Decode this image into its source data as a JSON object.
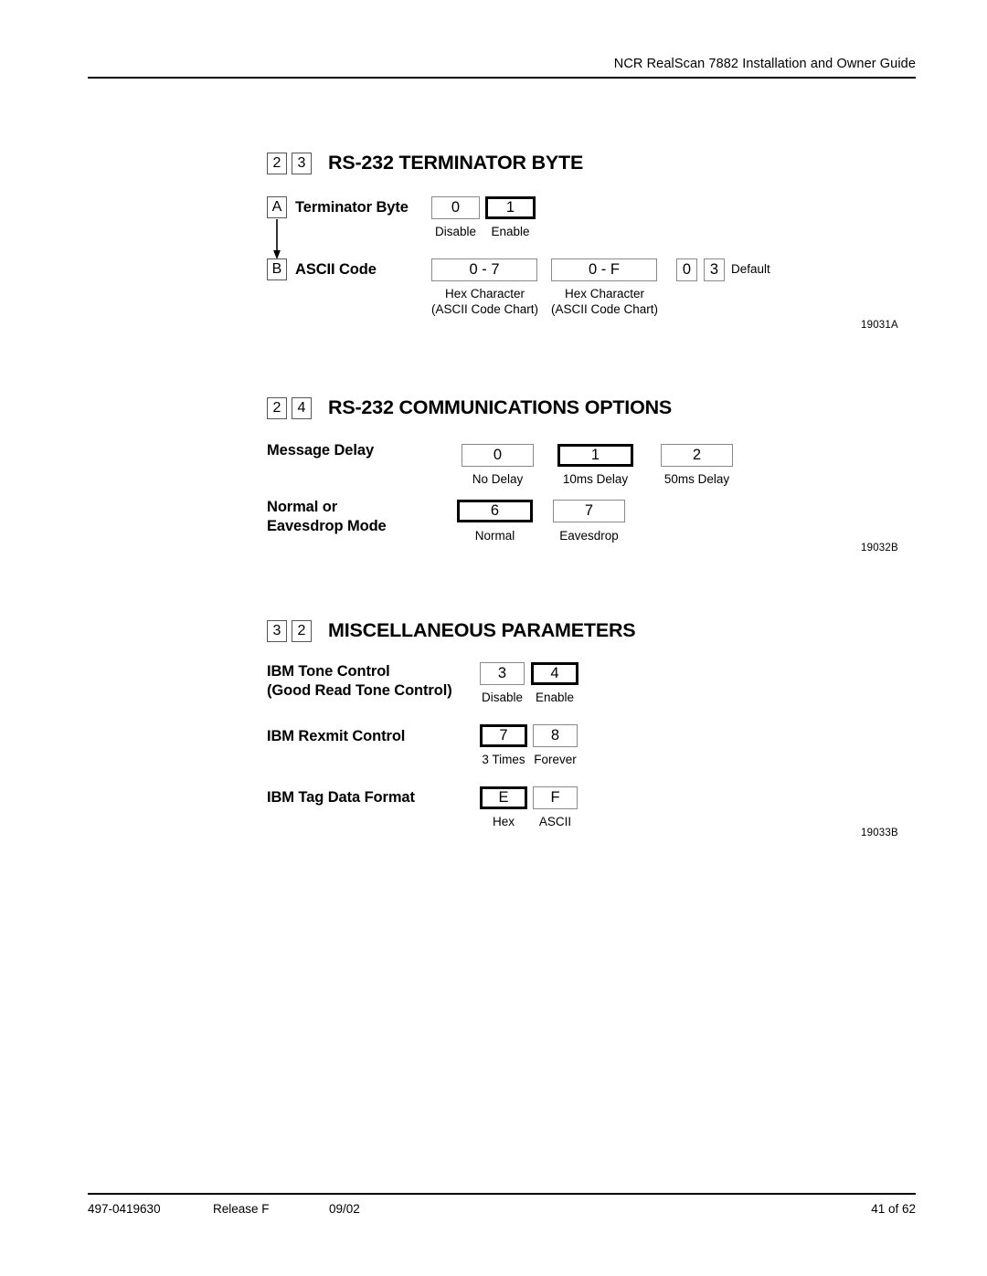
{
  "header": {
    "title": "NCR RealScan 7882 Installation and Owner Guide"
  },
  "footer": {
    "doc_number": "497-0419630",
    "release": "Release F",
    "date": "09/02",
    "page": "41 of 62"
  },
  "sections": [
    {
      "id": "rs232-terminator-byte",
      "num1": "2",
      "num2": "3",
      "title": "RS-232 TERMINATOR BYTE",
      "figure_id": "19031A",
      "rows": [
        {
          "tag": "A",
          "label": "Terminator Byte",
          "options": [
            {
              "value": "0",
              "caption": "Disable",
              "default": false
            },
            {
              "value": "1",
              "caption": "Enable",
              "default": true
            }
          ]
        },
        {
          "tag": "B",
          "label": "ASCII Code",
          "options": [
            {
              "value": "0 - 7",
              "caption": "Hex Character\n(ASCII Code Chart)",
              "default": false
            },
            {
              "value": "0 - F",
              "caption": "Hex Character\n(ASCII Code Chart)",
              "default": false
            }
          ],
          "default_tiles": [
            "0",
            "3"
          ],
          "default_label": "Default"
        }
      ]
    },
    {
      "id": "rs232-communications-options",
      "num1": "2",
      "num2": "4",
      "title": "RS-232 COMMUNICATIONS OPTIONS",
      "figure_id": "19032B",
      "rows": [
        {
          "label": "Message Delay",
          "options": [
            {
              "value": "0",
              "caption": "No Delay",
              "default": false
            },
            {
              "value": "1",
              "caption": "10ms Delay",
              "default": true
            },
            {
              "value": "2",
              "caption": "50ms Delay",
              "default": false
            }
          ]
        },
        {
          "label": "Normal or\nEavesdrop Mode",
          "label_line1": "Normal or",
          "label_line2": "Eavesdrop Mode",
          "options": [
            {
              "value": "6",
              "caption": "Normal",
              "default": true
            },
            {
              "value": "7",
              "caption": "Eavesdrop",
              "default": false
            }
          ]
        }
      ]
    },
    {
      "id": "miscellaneous-parameters",
      "num1": "3",
      "num2": "2",
      "title": "MISCELLANEOUS PARAMETERS",
      "figure_id": "19033B",
      "rows": [
        {
          "label": "IBM Tone Control\n(Good Read Tone Control)",
          "label_line1": "IBM Tone Control",
          "label_line2": "(Good Read Tone Control)",
          "options": [
            {
              "value": "3",
              "caption": "Disable",
              "default": false
            },
            {
              "value": "4",
              "caption": "Enable",
              "default": true
            }
          ]
        },
        {
          "label": "IBM Rexmit Control",
          "options": [
            {
              "value": "7",
              "caption": "3 Times",
              "default": true
            },
            {
              "value": "8",
              "caption": "Forever",
              "default": false
            }
          ]
        },
        {
          "label": "IBM Tag Data Format",
          "options": [
            {
              "value": "E",
              "caption": "Hex",
              "default": true
            },
            {
              "value": "F",
              "caption": "ASCII",
              "default": false
            }
          ]
        }
      ]
    }
  ]
}
